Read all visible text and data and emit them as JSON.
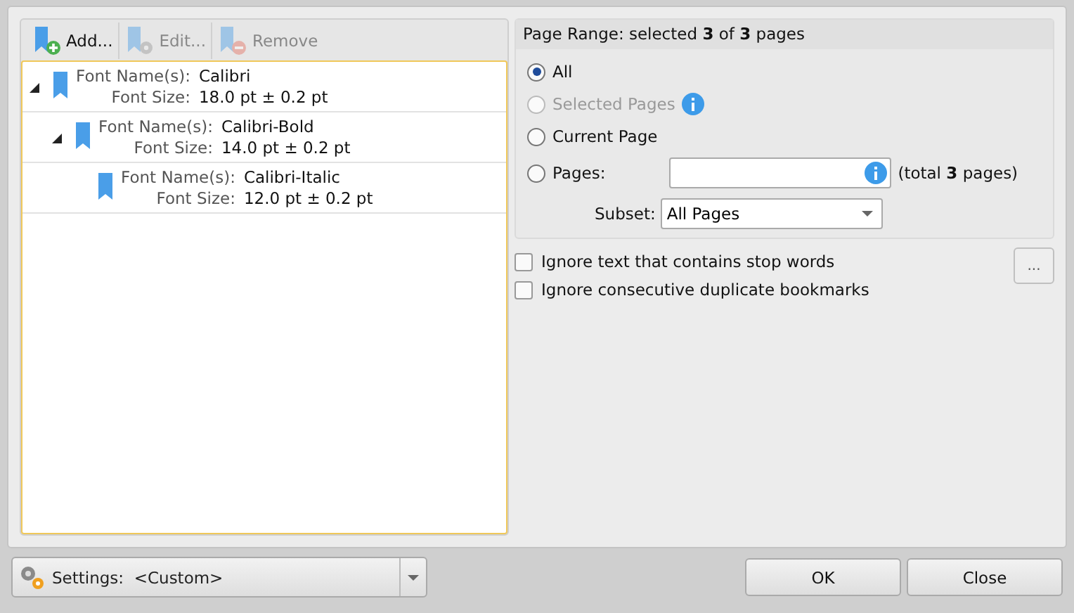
{
  "toolbar": [
    {
      "label": "Add...",
      "kind": "add",
      "disabled": false
    },
    {
      "label": "Edit...",
      "kind": "edit",
      "disabled": true
    },
    {
      "label": "Remove",
      "kind": "remove",
      "disabled": true
    }
  ],
  "tree": [
    {
      "name_label": "Font Name(s):",
      "name": "Calibri",
      "size_label": "Font Size:",
      "size": "18.0 pt ± 0.2 pt",
      "expanded": true,
      "children": [
        {
          "name_label": "Font Name(s):",
          "name": "Calibri-Bold",
          "size_label": "Font Size:",
          "size": "14.0 pt ± 0.2 pt",
          "expanded": true,
          "children": [
            {
              "name_label": "Font Name(s):",
              "name": "Calibri-Italic",
              "size_label": "Font Size:",
              "size": "12.0 pt ± 0.2 pt"
            }
          ]
        }
      ]
    }
  ],
  "page_range": {
    "title": "Page Range: selected **3** of **3** pages",
    "radios": [
      {
        "label": "All",
        "kind": "plain",
        "selected": true,
        "disabled": false
      },
      {
        "label": "Selected Pages",
        "kind": "info",
        "selected": false,
        "disabled": true
      },
      {
        "label": "Current Page",
        "kind": "plain",
        "selected": false,
        "disabled": false
      },
      {
        "label": "Pages:",
        "kind": "pages",
        "selected": false,
        "disabled": false,
        "note": "(total **3** pages)"
      }
    ],
    "subset": {
      "label": "Subset:",
      "value": "All Pages"
    }
  },
  "options": [
    {
      "label": "Ignore text that contains stop words",
      "checked": false,
      "button": "..."
    },
    {
      "label": "Ignore consecutive duplicate bookmarks",
      "checked": false
    }
  ],
  "footer": {
    "settings_label": "Settings:",
    "settings_value": "<Custom>",
    "buttons": [
      "OK",
      "Close"
    ]
  }
}
